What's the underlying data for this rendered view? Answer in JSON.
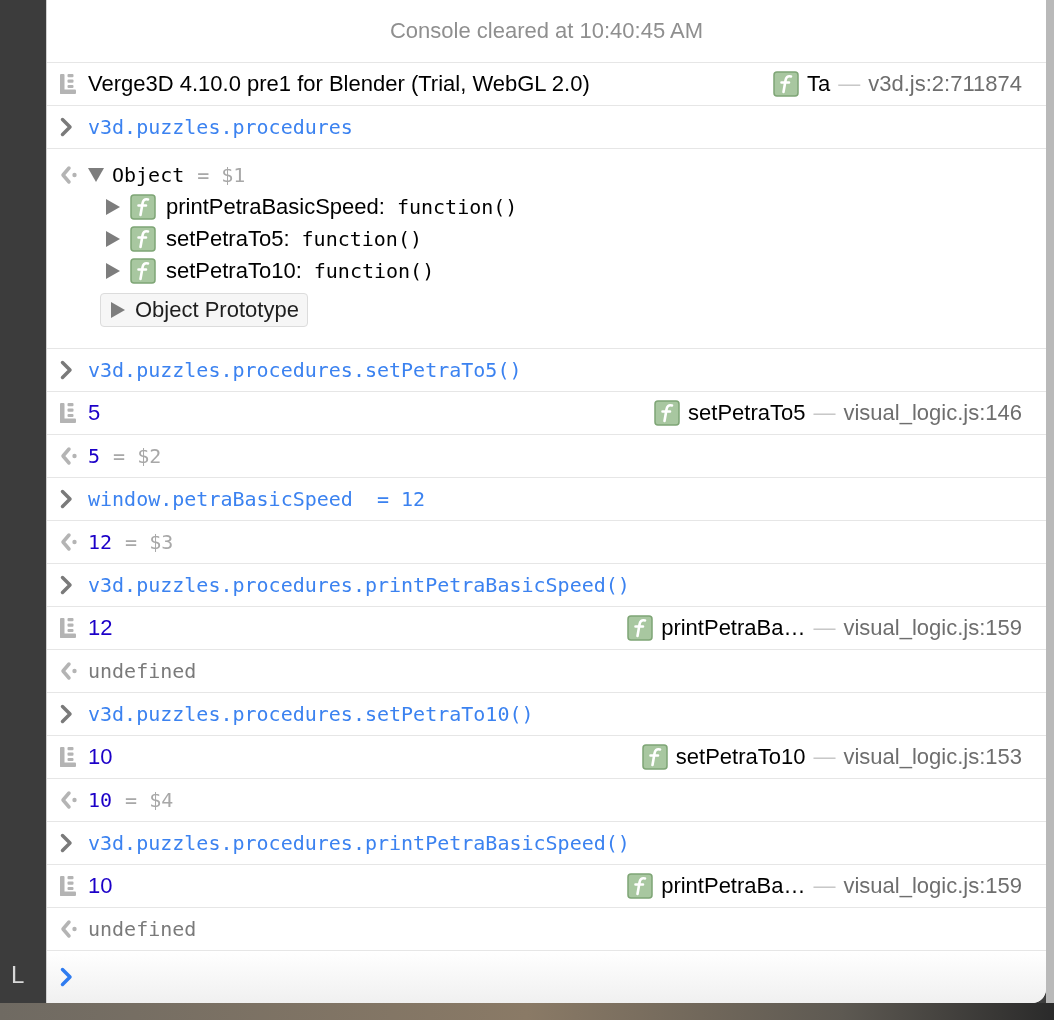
{
  "side_text": "L",
  "console": {
    "cleared_message": "Console cleared at 10:40:45 AM",
    "entries": [
      {
        "kind": "log",
        "value": {
          "kind": "string",
          "text": "Verge3D 4.10.0 pre1 for Blender (Trial, WebGL 2.0)"
        },
        "source": {
          "function": "Ta",
          "separator": "—",
          "location": "v3d.js:2:711874"
        }
      },
      {
        "kind": "input",
        "text": "v3d.puzzles.procedures"
      },
      {
        "kind": "object",
        "expanded": true,
        "label": "Object",
        "ref": "= $1",
        "properties": [
          {
            "name": "printPetraBasicSpeed:",
            "value": "function()",
            "expanded": false
          },
          {
            "name": "setPetraTo5:",
            "value": "function()",
            "expanded": false
          },
          {
            "name": "setPetraTo10:",
            "value": "function()",
            "expanded": false
          }
        ],
        "prototype": {
          "label": "Object Prototype",
          "expanded": false
        }
      },
      {
        "kind": "input",
        "text": "v3d.puzzles.procedures.setPetraTo5()"
      },
      {
        "kind": "log",
        "value": {
          "kind": "number",
          "text": "5"
        },
        "source": {
          "function": "setPetraTo5",
          "separator": "—",
          "location": "visual_logic.js:146"
        }
      },
      {
        "kind": "result",
        "value": {
          "kind": "number",
          "text": "5"
        },
        "ref": "= $2"
      },
      {
        "kind": "input",
        "text": "window.petraBasicSpeed  = 12"
      },
      {
        "kind": "result",
        "value": {
          "kind": "number",
          "text": "12"
        },
        "ref": "= $3"
      },
      {
        "kind": "input",
        "text": "v3d.puzzles.procedures.printPetraBasicSpeed()"
      },
      {
        "kind": "log",
        "value": {
          "kind": "number",
          "text": "12"
        },
        "source": {
          "function": "printPetraBa…",
          "separator": "—",
          "location": "visual_logic.js:159"
        }
      },
      {
        "kind": "result",
        "value": {
          "kind": "undefined",
          "text": "undefined"
        }
      },
      {
        "kind": "input",
        "text": "v3d.puzzles.procedures.setPetraTo10()"
      },
      {
        "kind": "log",
        "value": {
          "kind": "number",
          "text": "10"
        },
        "source": {
          "function": "setPetraTo10",
          "separator": "—",
          "location": "visual_logic.js:153"
        }
      },
      {
        "kind": "result",
        "value": {
          "kind": "number",
          "text": "10"
        },
        "ref": "= $4"
      },
      {
        "kind": "input",
        "text": "v3d.puzzles.procedures.printPetraBasicSpeed()"
      },
      {
        "kind": "log",
        "value": {
          "kind": "number",
          "text": "10"
        },
        "source": {
          "function": "printPetraBa…",
          "separator": "—",
          "location": "visual_logic.js:159"
        }
      },
      {
        "kind": "result",
        "value": {
          "kind": "undefined",
          "text": "undefined"
        }
      }
    ]
  }
}
